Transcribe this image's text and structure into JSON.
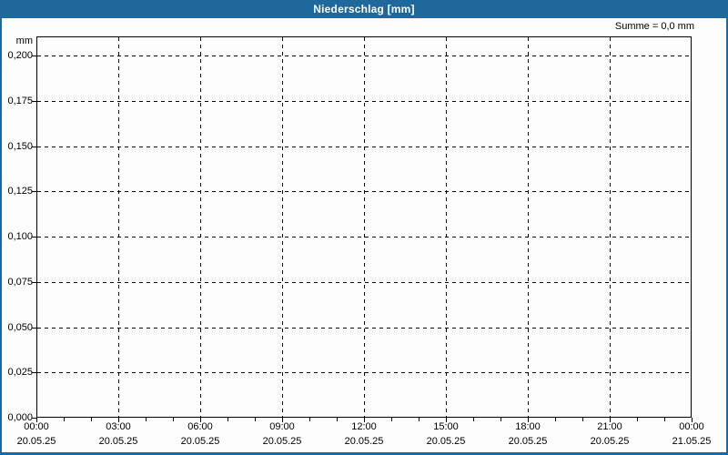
{
  "window": {
    "title": "Niederschlag [mm]",
    "frame_color": "#1f689b",
    "title_text_color": "#ffffff"
  },
  "annotation": {
    "sum_label": "Summe = 0,0 mm"
  },
  "chart_data": {
    "type": "bar",
    "title": "Niederschlag [mm]",
    "subtitle": "",
    "annotation": "Summe = 0,0 mm",
    "xlabel": "",
    "ylabel": "mm",
    "grid": true,
    "legend": "none",
    "series": [
      {
        "name": "Niederschlag",
        "values": [],
        "sum_mm": 0.0
      }
    ],
    "y_axis": {
      "unit": "mm",
      "min": 0.0,
      "max": 0.2,
      "step": 0.025,
      "ticks": [
        {
          "value": 0.0,
          "label": "0,000"
        },
        {
          "value": 0.025,
          "label": "0,025"
        },
        {
          "value": 0.05,
          "label": "0,050"
        },
        {
          "value": 0.075,
          "label": "0,075"
        },
        {
          "value": 0.1,
          "label": "0,100"
        },
        {
          "value": 0.125,
          "label": "0,125"
        },
        {
          "value": 0.15,
          "label": "0,150"
        },
        {
          "value": 0.175,
          "label": "0,175"
        },
        {
          "value": 0.2,
          "label": "0,200"
        }
      ]
    },
    "x_axis": {
      "total_hours": 24,
      "minor_step_hours": 1,
      "major_step_hours": 3,
      "major_labels": [
        {
          "time": "00:00",
          "date": "20.05.25"
        },
        {
          "time": "03:00",
          "date": "20.05.25"
        },
        {
          "time": "06:00",
          "date": "20.05.25"
        },
        {
          "time": "09:00",
          "date": "20.05.25"
        },
        {
          "time": "12:00",
          "date": "20.05.25"
        },
        {
          "time": "15:00",
          "date": "20.05.25"
        },
        {
          "time": "18:00",
          "date": "20.05.25"
        },
        {
          "time": "21:00",
          "date": "20.05.25"
        },
        {
          "time": "00:00",
          "date": "21.05.25"
        }
      ]
    }
  }
}
